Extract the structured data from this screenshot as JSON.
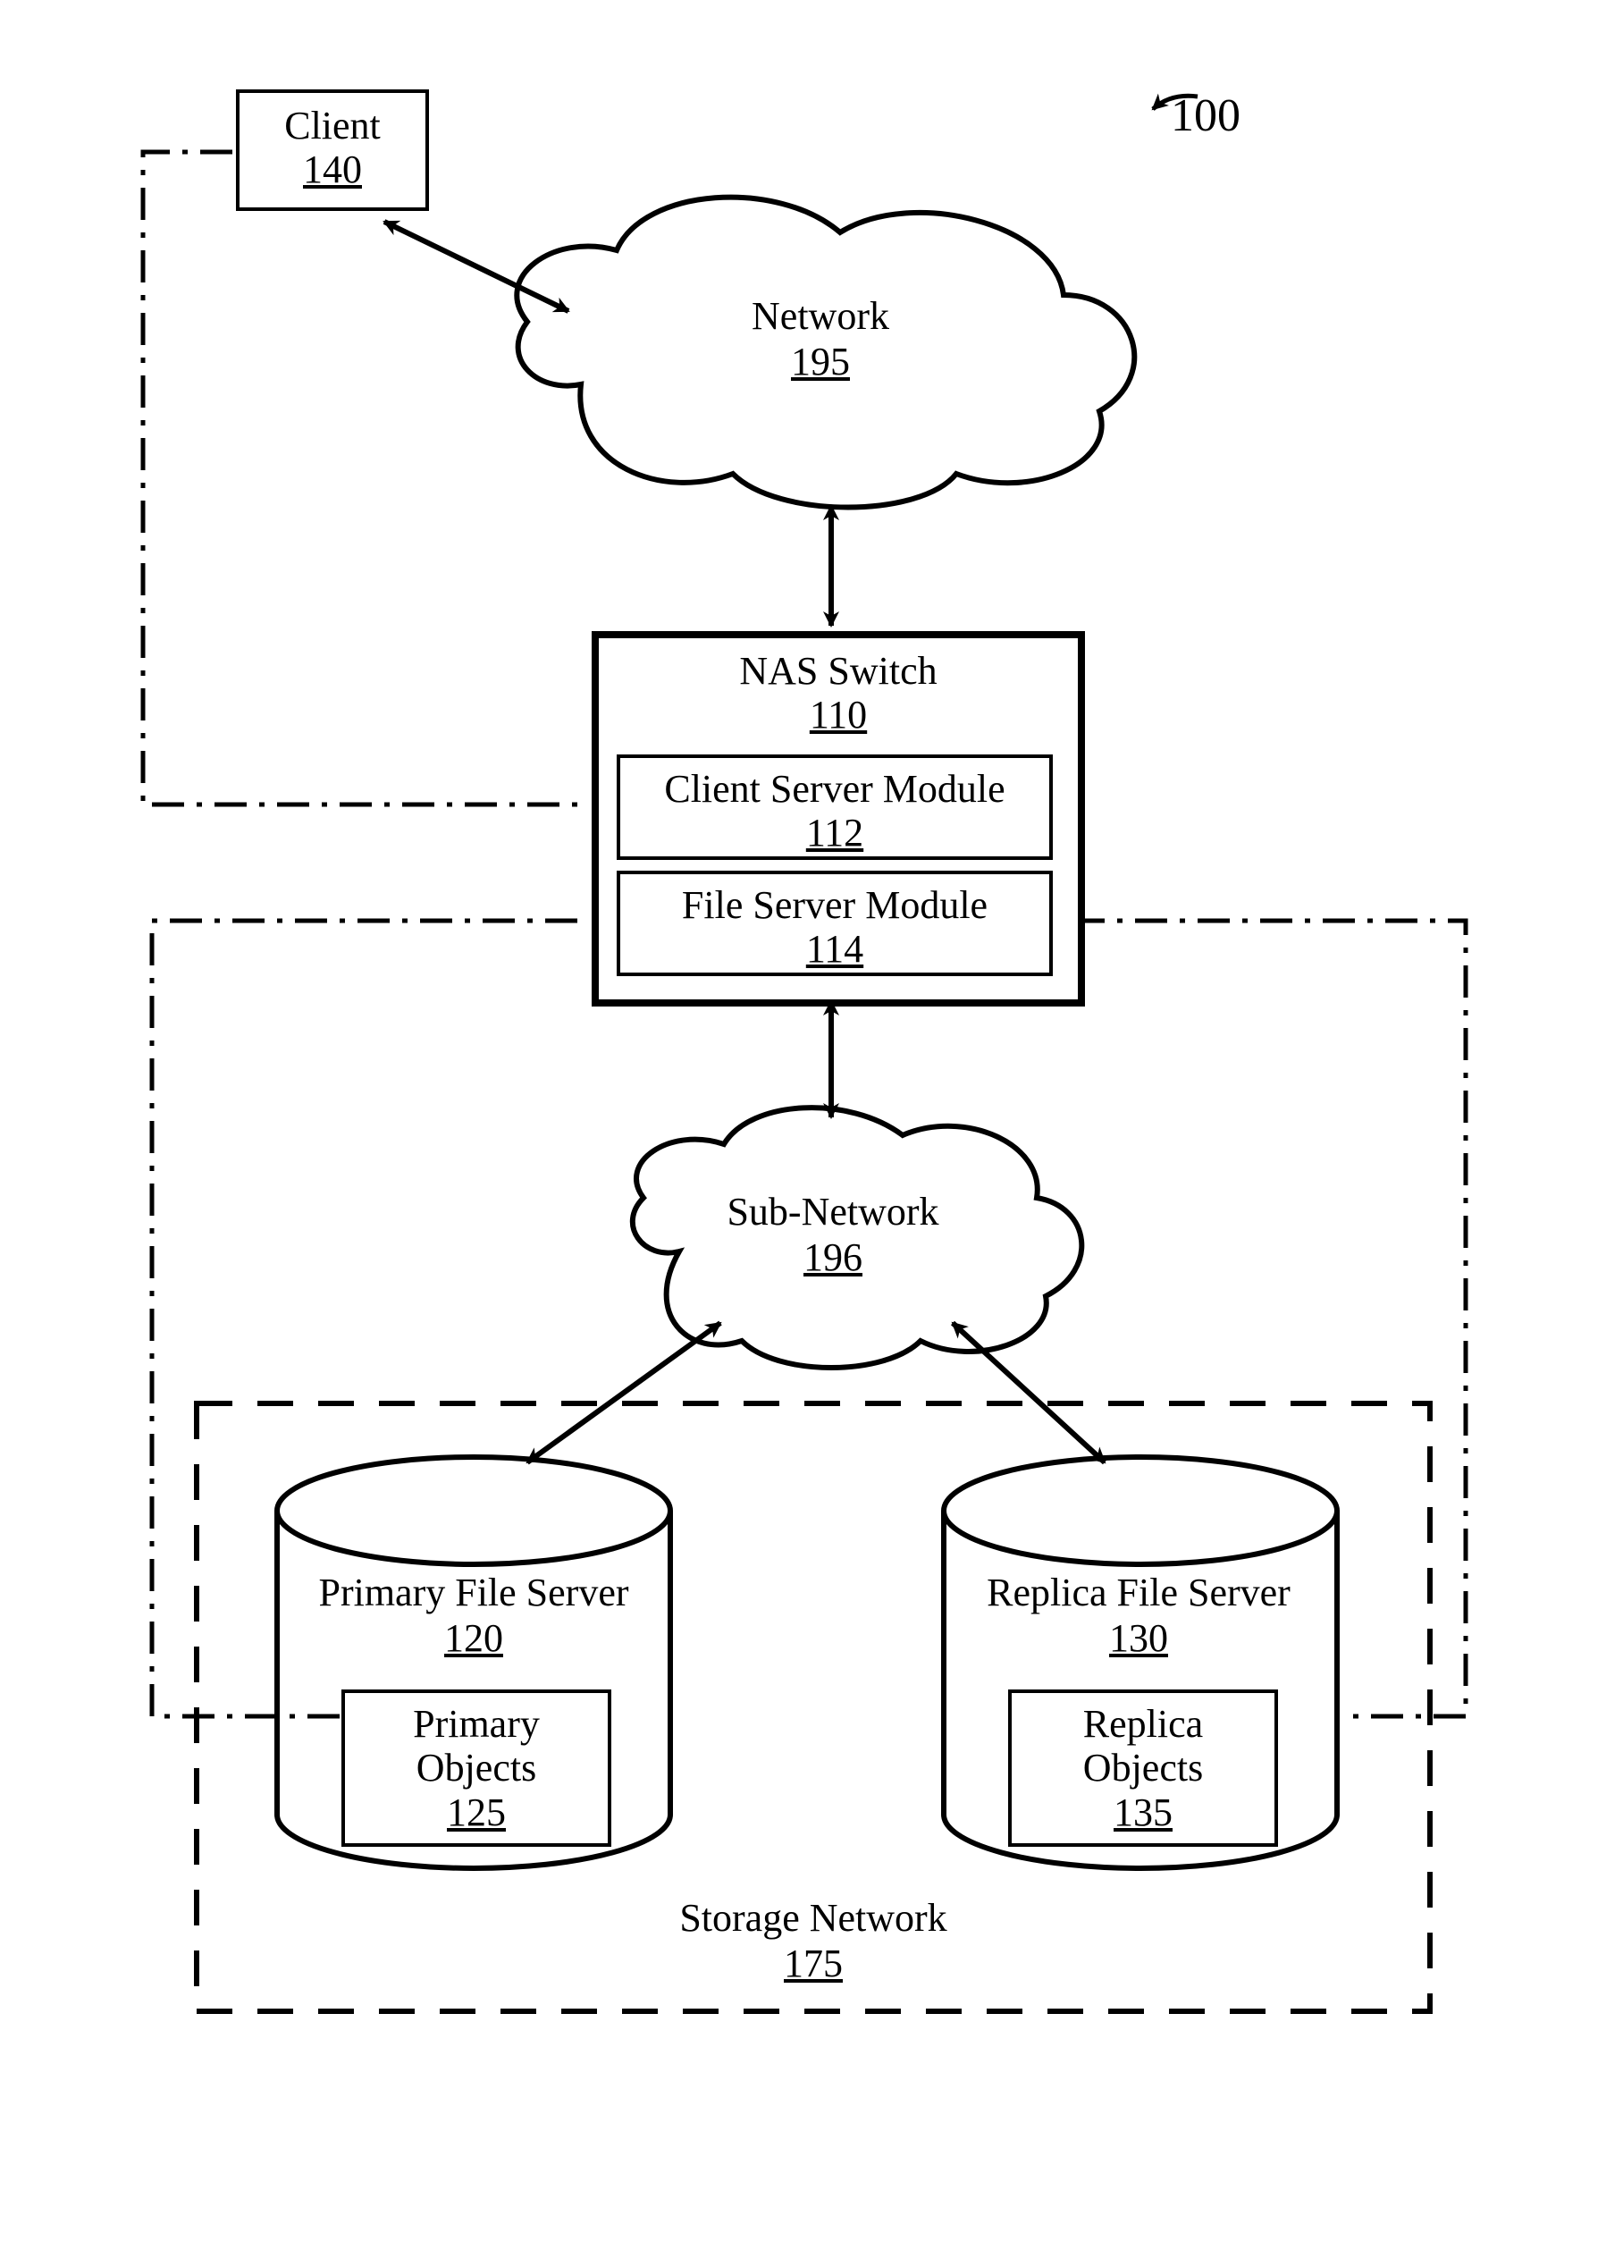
{
  "ref": "100",
  "client": {
    "label": "Client",
    "num": "140"
  },
  "network": {
    "label": "Network",
    "num": "195"
  },
  "nas": {
    "label": "NAS Switch",
    "num": "110"
  },
  "csm": {
    "label": "Client Server Module",
    "num": "112"
  },
  "fsm": {
    "label": "File Server Module",
    "num": "114"
  },
  "subnet": {
    "label": "Sub-Network",
    "num": "196"
  },
  "storage": {
    "label": "Storage Network",
    "num": "175"
  },
  "pfs": {
    "label": "Primary File Server",
    "num": "120"
  },
  "pobj": {
    "label": "Primary Objects",
    "num": "125"
  },
  "rfs": {
    "label": "Replica File Server",
    "num": "130"
  },
  "robj": {
    "label": "Replica Objects",
    "num": "135"
  }
}
